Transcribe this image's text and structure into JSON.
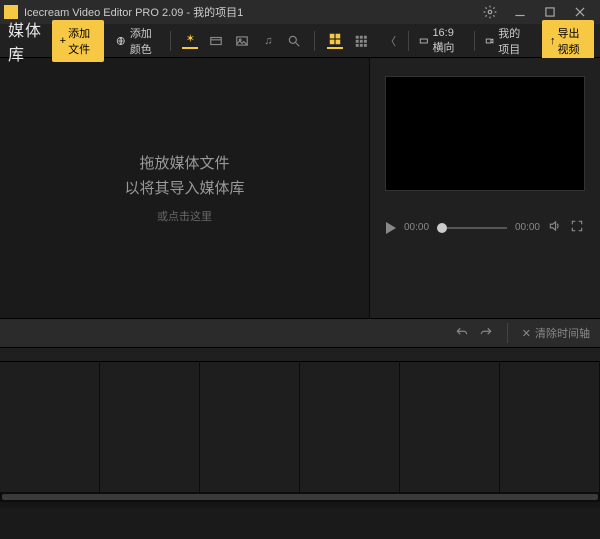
{
  "titlebar": {
    "title": "Icecream Video Editor PRO 2.09  - 我的项目1"
  },
  "toolbar": {
    "library_label": "媒体库",
    "add_file": "添加文件",
    "add_color": "添加颜色",
    "aspect": "16:9 横向",
    "my_projects": "我的项目",
    "export": "导出视频"
  },
  "media": {
    "drop_line1": "拖放媒体文件",
    "drop_line2": "以将其导入媒体库",
    "drop_sub": "或点击这里"
  },
  "transport": {
    "current": "00:00",
    "total": "00:00"
  },
  "timeline": {
    "clear": "清除时间轴"
  }
}
